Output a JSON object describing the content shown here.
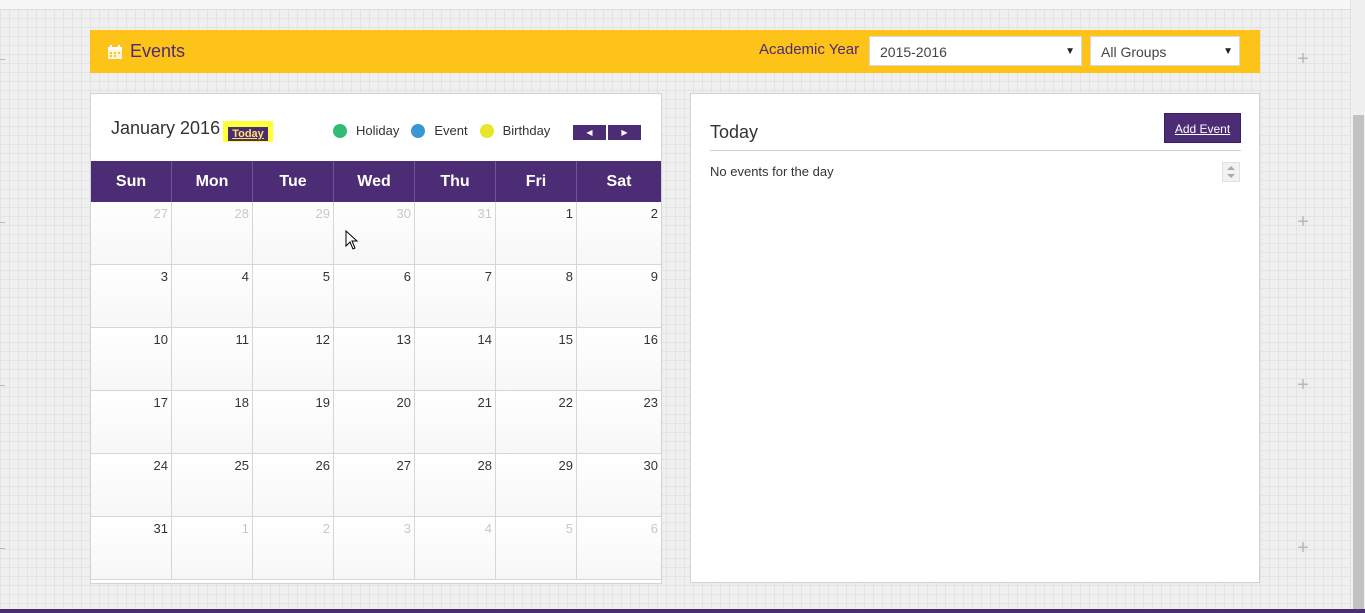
{
  "header": {
    "title": "Events",
    "academic_year_label": "Academic Year",
    "year_select_value": "2015-2016",
    "group_select_value": "All Groups"
  },
  "calendar": {
    "month_title": "January 2016",
    "today_button": "Today",
    "legend": [
      {
        "label": "Holiday",
        "color": "#2ebd73"
      },
      {
        "label": "Event",
        "color": "#3a97d6"
      },
      {
        "label": "Birthday",
        "color": "#e6e62a"
      }
    ],
    "weekdays": [
      "Sun",
      "Mon",
      "Tue",
      "Wed",
      "Thu",
      "Fri",
      "Sat"
    ],
    "weeks": [
      [
        {
          "d": "27",
          "o": true
        },
        {
          "d": "28",
          "o": true
        },
        {
          "d": "29",
          "o": true
        },
        {
          "d": "30",
          "o": true
        },
        {
          "d": "31",
          "o": true
        },
        {
          "d": "1",
          "o": false
        },
        {
          "d": "2",
          "o": false
        }
      ],
      [
        {
          "d": "3",
          "o": false
        },
        {
          "d": "4",
          "o": false
        },
        {
          "d": "5",
          "o": false
        },
        {
          "d": "6",
          "o": false
        },
        {
          "d": "7",
          "o": false
        },
        {
          "d": "8",
          "o": false
        },
        {
          "d": "9",
          "o": false
        }
      ],
      [
        {
          "d": "10",
          "o": false
        },
        {
          "d": "11",
          "o": false
        },
        {
          "d": "12",
          "o": false
        },
        {
          "d": "13",
          "o": false
        },
        {
          "d": "14",
          "o": false
        },
        {
          "d": "15",
          "o": false
        },
        {
          "d": "16",
          "o": false
        }
      ],
      [
        {
          "d": "17",
          "o": false
        },
        {
          "d": "18",
          "o": false
        },
        {
          "d": "19",
          "o": false
        },
        {
          "d": "20",
          "o": false
        },
        {
          "d": "21",
          "o": false
        },
        {
          "d": "22",
          "o": false
        },
        {
          "d": "23",
          "o": false
        }
      ],
      [
        {
          "d": "24",
          "o": false
        },
        {
          "d": "25",
          "o": false
        },
        {
          "d": "26",
          "o": false
        },
        {
          "d": "27",
          "o": false
        },
        {
          "d": "28",
          "o": false
        },
        {
          "d": "29",
          "o": false
        },
        {
          "d": "30",
          "o": false
        }
      ],
      [
        {
          "d": "31",
          "o": false
        },
        {
          "d": "1",
          "o": true
        },
        {
          "d": "2",
          "o": true
        },
        {
          "d": "3",
          "o": true
        },
        {
          "d": "4",
          "o": true
        },
        {
          "d": "5",
          "o": true
        },
        {
          "d": "6",
          "o": true
        }
      ]
    ]
  },
  "today_panel": {
    "title": "Today",
    "add_event_label": "Add Event",
    "empty_message": "No events for the day"
  },
  "colors": {
    "accent": "#fdc319",
    "brand": "#4b2c75"
  }
}
